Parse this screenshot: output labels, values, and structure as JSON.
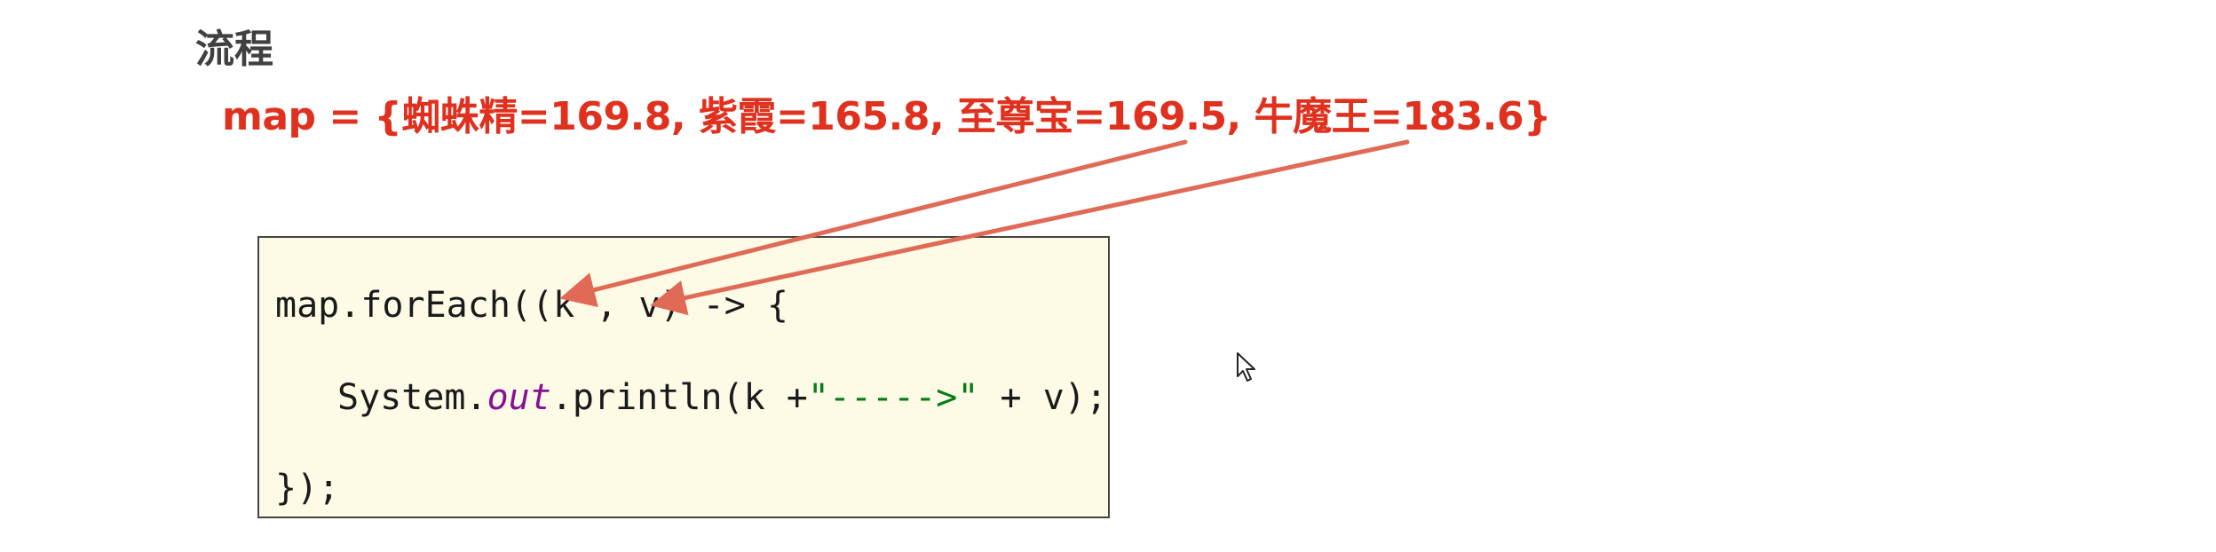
{
  "slide": {
    "title": "流程",
    "map_line": "map = {蜘蛛精=169.8, 紫霞=165.8, 至尊宝=169.5, 牛魔王=183.6}"
  },
  "code": {
    "line1": "map.forEach((k , v) -> {",
    "line2_prefix": "System.",
    "line2_out": "out",
    "line2_mid": ".println(k +",
    "line2_string": "\"----->\"",
    "line2_suffix": " + v);",
    "line3": "});"
  },
  "colors": {
    "title": "#404040",
    "map_text": "#e0301e",
    "arrow": "#e06a55",
    "code_bg": "#fdfbe6",
    "code_border": "#444444",
    "keyword_out": "#871094",
    "string": "#067d17"
  },
  "icons": {
    "cursor": "mouse-pointer-icon",
    "arrows": "annotation-arrow-icon"
  }
}
